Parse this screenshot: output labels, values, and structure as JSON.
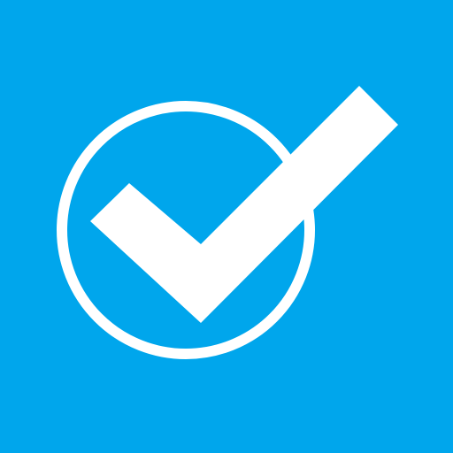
{
  "app_icon": {
    "icon": "circle-checkmark-icon",
    "glyph": "check-icon",
    "ring": "circle-icon",
    "colors": {
      "background": "#00a6ec",
      "foreground": "#ffffff"
    }
  }
}
